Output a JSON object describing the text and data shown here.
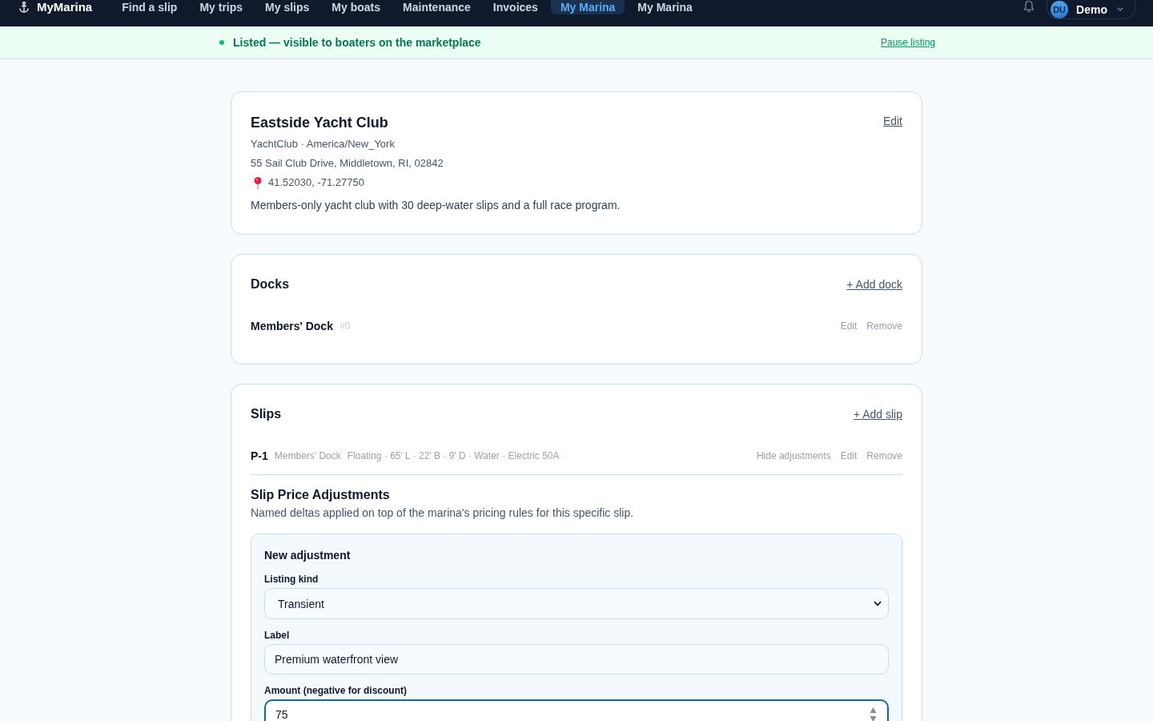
{
  "nav": {
    "brand": "MyMarina",
    "links": [
      {
        "label": "Find a slip",
        "selected": false
      },
      {
        "label": "My trips",
        "selected": false
      },
      {
        "label": "My slips",
        "selected": false
      },
      {
        "label": "My boats",
        "selected": false
      },
      {
        "label": "Maintenance",
        "selected": false
      },
      {
        "label": "Invoices",
        "selected": false
      },
      {
        "label": "My Marina",
        "selected": true
      },
      {
        "label": "My Marina",
        "selected": false
      }
    ],
    "user": {
      "initials": "DU",
      "name": "Demo"
    }
  },
  "banner": {
    "status": "Listed — visible to boaters on the marketplace",
    "action": "Pause listing"
  },
  "marina": {
    "name": "Eastside Yacht Club",
    "edit": "Edit",
    "meta": "YachtClub · America/New_York",
    "address": "55 Sail Club Drive, Middletown, RI, 02842",
    "coordinates": "41.52030, -71.27750",
    "description": "Members-only yacht club with 30 deep-water slips and a full race program."
  },
  "docks": {
    "title": "Docks",
    "add": "+ Add dock",
    "items": [
      {
        "name": "Members' Dock",
        "number": "#0",
        "actions": [
          "Edit",
          "Remove"
        ]
      }
    ]
  },
  "slips": {
    "title": "Slips",
    "add": "+ Add slip",
    "items": [
      {
        "name": "P-1",
        "dock": "Members' Dock",
        "details": "Floating · 65' L · 22' B · 9' D · Water · Electric 50A",
        "actions": [
          "Hide adjustments",
          "Edit",
          "Remove"
        ],
        "expanded": true,
        "adjustments": {
          "title": "Slip Price Adjustments",
          "description": "Named deltas applied on top of the marina's pricing rules for this specific slip.",
          "form": {
            "title": "New adjustment",
            "fields": [
              {
                "kind": "select",
                "label": "Listing kind",
                "value": "Transient",
                "focused": false
              },
              {
                "kind": "text",
                "label": "Label",
                "value": "Premium waterfront view",
                "focused": false
              },
              {
                "kind": "number",
                "label": "Amount (negative for discount)",
                "value": "75",
                "focused": true
              }
            ]
          }
        }
      }
    ]
  }
}
